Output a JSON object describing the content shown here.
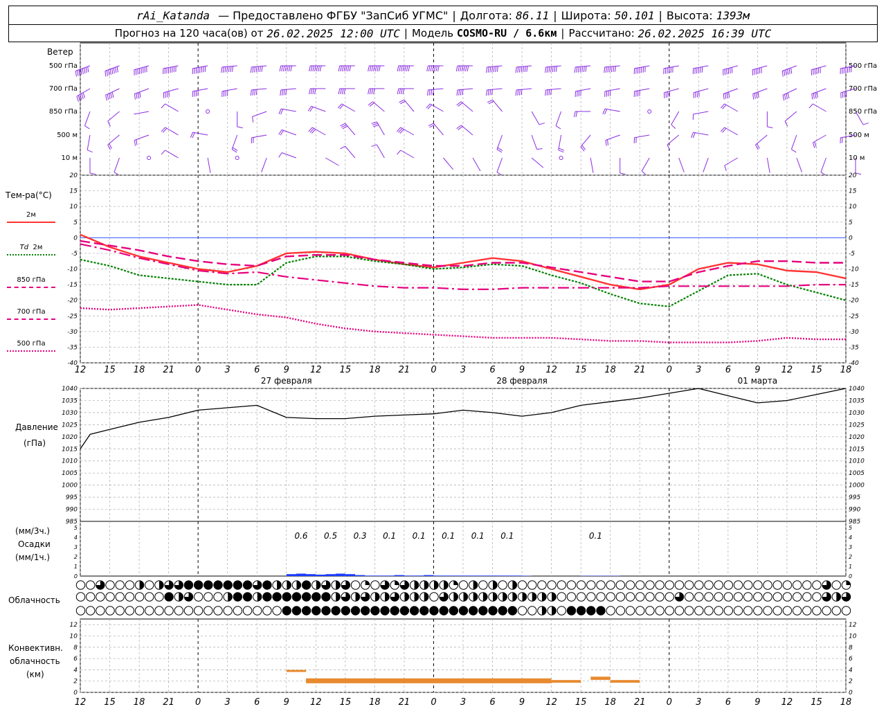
{
  "header": {
    "station": "rAi_Katanda",
    "provider": "— Предоставлено ФГБУ \"ЗапСиб УГМС\"",
    "lon_label": "Долгота:",
    "lon": "86.11",
    "lat_label": "Широта:",
    "lat": "50.101",
    "alt_label": "Высота:",
    "alt": "1393м",
    "forecast_prefix": "Прогноз на 120 часа(ов) от",
    "forecast_time": "26.02.2025 12:00 UTC",
    "model_label": "Модель",
    "model": "COSMO-RU / 6.6км",
    "calc_label": "Рассчитано:",
    "calc_time": "26.02.2025 16:39 UTC"
  },
  "panel_labels": {
    "wind": "Ветер",
    "temp": "Тем-ра(°С)",
    "pressure": "Давление",
    "pressure_unit": "(гПа)",
    "precip_unit_3h": "(мм/3ч.)",
    "precip": "Осадки",
    "precip_unit_1h": "(мм/1ч.)",
    "cloud": "Облачность",
    "conv1": "Конвективн.",
    "conv2": "облачность",
    "conv_unit": "(км)"
  },
  "wind_levels": [
    "500 гПа",
    "700 гПа",
    "850 гПа",
    "500 м",
    "10  м"
  ],
  "legend": {
    "t2m": "2м",
    "td": "Td",
    "td2m": "2м",
    "t850": "850 гПа",
    "t700": "700 гПа",
    "t500": "500 гПа"
  },
  "colors": {
    "t2m": "#ff3333",
    "td2m": "#008000",
    "t850": "#e6007e",
    "t700": "#e6007e",
    "t500": "#e6007e",
    "wind": "#8a2be2",
    "pressure": "#000000",
    "precip": "#1a3cff",
    "conv": "#e88a2e",
    "zero": "#3355ff"
  },
  "time_axis": {
    "tick_labels": [
      "12",
      "15",
      "18",
      "21",
      "0",
      "3",
      "6",
      "9",
      "12",
      "15",
      "18",
      "21",
      "0",
      "3",
      "6",
      "9",
      "12",
      "15",
      "18",
      "21",
      "0",
      "3",
      "6",
      "9",
      "12",
      "15",
      "18"
    ],
    "day_labels": [
      {
        "hour": 21,
        "text": "27 февраля"
      },
      {
        "hour": 45,
        "text": "28 февраля"
      },
      {
        "hour": 69,
        "text": "01 марта"
      }
    ]
  },
  "chart_data": {
    "type": "line",
    "x_unit": "hours since 26.02.2025 12:00 UTC",
    "temperature": {
      "ylim": [
        -40,
        20
      ],
      "yticks": [
        20,
        15,
        10,
        5,
        0,
        -5,
        -10,
        -15,
        -20,
        -25,
        -30,
        -35,
        -40
      ],
      "series": [
        {
          "key": "t2m",
          "x": [
            0,
            3,
            6,
            9,
            12,
            15,
            18,
            21,
            24,
            27,
            30,
            33,
            36,
            39,
            42,
            45,
            48,
            51,
            54,
            57,
            60,
            63,
            66,
            69,
            72,
            75,
            78
          ],
          "values": [
            1,
            -3,
            -6,
            -8,
            -10,
            -11,
            -9,
            -5,
            -4.5,
            -5,
            -7,
            -8.5,
            -9.5,
            -8,
            -6.5,
            -7.5,
            -10,
            -12.5,
            -15,
            -16.5,
            -15,
            -10,
            -8,
            -8.5,
            -10.5,
            -11,
            -13
          ]
        },
        {
          "key": "td2m",
          "x": [
            0,
            3,
            6,
            9,
            12,
            15,
            18,
            21,
            24,
            27,
            30,
            33,
            36,
            39,
            42,
            45,
            48,
            51,
            54,
            57,
            60,
            63,
            66,
            69,
            72,
            75,
            78
          ],
          "values": [
            -7,
            -9,
            -12,
            -13,
            -14,
            -15,
            -15,
            -8,
            -6,
            -6,
            -7.5,
            -8.5,
            -10,
            -9.5,
            -8.5,
            -9,
            -12,
            -14.5,
            -18,
            -21,
            -22,
            -17,
            -12,
            -11.5,
            -15,
            -17.5,
            -20
          ]
        },
        {
          "key": "t850",
          "x": [
            0,
            3,
            6,
            9,
            12,
            15,
            18,
            21,
            24,
            27,
            30,
            33,
            36,
            39,
            42,
            45,
            48,
            51,
            54,
            57,
            60,
            63,
            66,
            69,
            72,
            75,
            78
          ],
          "values": [
            -1,
            -2.5,
            -4,
            -6,
            -7.5,
            -8.5,
            -9,
            -6,
            -5.5,
            -5.5,
            -7,
            -8,
            -9,
            -9,
            -8,
            -8,
            -9.5,
            -11,
            -12.5,
            -14,
            -14,
            -11,
            -9,
            -7.5,
            -7.5,
            -8,
            -8
          ]
        },
        {
          "key": "t700",
          "x": [
            0,
            3,
            6,
            9,
            12,
            15,
            18,
            21,
            24,
            27,
            30,
            33,
            36,
            39,
            42,
            45,
            48,
            51,
            54,
            57,
            60,
            63,
            66,
            69,
            72,
            75,
            78
          ],
          "values": [
            -2,
            -4,
            -6.5,
            -8.5,
            -10.5,
            -11.5,
            -11,
            -12.5,
            -13.5,
            -14.5,
            -15.5,
            -16,
            -16,
            -16.5,
            -16.5,
            -16,
            -16,
            -16,
            -16,
            -16,
            -15.5,
            -15.5,
            -15.5,
            -15.5,
            -15.5,
            -15,
            -15
          ]
        },
        {
          "key": "t500",
          "x": [
            0,
            3,
            6,
            9,
            12,
            15,
            18,
            21,
            24,
            27,
            30,
            33,
            36,
            39,
            42,
            45,
            48,
            51,
            54,
            57,
            60,
            63,
            66,
            69,
            72,
            75,
            78
          ],
          "values": [
            -22.5,
            -23,
            -22.5,
            -22,
            -21.5,
            -23,
            -24.5,
            -25.5,
            -27.5,
            -29,
            -30,
            -30.5,
            -31,
            -31.5,
            -32,
            -32,
            -32,
            -32.5,
            -33,
            -33,
            -33.5,
            -33.5,
            -33.5,
            -33,
            -32,
            -32.5,
            -32.5
          ]
        }
      ]
    },
    "pressure": {
      "ylim": [
        985,
        1040
      ],
      "yticks": [
        1040,
        1035,
        1030,
        1025,
        1020,
        1015,
        1010,
        1005,
        1000,
        995,
        990,
        985
      ],
      "x": [
        0,
        1,
        3,
        6,
        9,
        12,
        15,
        18,
        21,
        24,
        27,
        30,
        33,
        36,
        39,
        42,
        45,
        48,
        51,
        54,
        57,
        60,
        63,
        66,
        69,
        72,
        75,
        78
      ],
      "values": [
        1015,
        1021,
        1023,
        1026,
        1028,
        1031,
        1032,
        1033,
        1028,
        1027.5,
        1027.5,
        1028.5,
        1029,
        1029.5,
        1031,
        1030,
        1028.5,
        1030,
        1033,
        1034.5,
        1036,
        1038,
        1040,
        1037,
        1034,
        1035,
        1037.5,
        1040
      ]
    },
    "precip": {
      "ylim": [
        0,
        5
      ],
      "yticks": [
        5,
        4,
        3,
        2,
        1,
        0
      ],
      "labels_3h": [
        {
          "x": 22.5,
          "text": "0.6"
        },
        {
          "x": 25.5,
          "text": "0.5"
        },
        {
          "x": 28.5,
          "text": "0.3"
        },
        {
          "x": 31.5,
          "text": "0.1"
        },
        {
          "x": 34.5,
          "text": "0.1"
        },
        {
          "x": 37.5,
          "text": "0.1"
        },
        {
          "x": 40.5,
          "text": "0.1"
        },
        {
          "x": 43.5,
          "text": "0.1"
        },
        {
          "x": 52.5,
          "text": "0.1"
        }
      ],
      "hourly_x": [
        21,
        22,
        23,
        24,
        25,
        26,
        27,
        28,
        29,
        30,
        31,
        32,
        33,
        34,
        35,
        36,
        37,
        38,
        39,
        40,
        41,
        42,
        43,
        44,
        45,
        51,
        52,
        53,
        54
      ],
      "hourly_values": [
        0.2,
        0.25,
        0.2,
        0.15,
        0.2,
        0.25,
        0.2,
        0.1,
        0.05,
        0.05,
        0.05,
        0.1,
        0.05,
        0.05,
        0.1,
        0.05,
        0.05,
        0.05,
        0.05,
        0.05,
        0.05,
        0.05,
        0.05,
        0.05,
        0.03,
        0.03,
        0.03,
        0.03,
        0.03
      ]
    },
    "cloud": {
      "rows": 3,
      "levels_lmh_each_hour": "cover fraction 0–1 per hour (row 0 = top)",
      "x_step_hours": 1,
      "row0": [
        0,
        0,
        0.75,
        0,
        0,
        0,
        0.5,
        0,
        0.5,
        0.75,
        0.75,
        1,
        1,
        1,
        1,
        1,
        1,
        1,
        0.75,
        1,
        0.5,
        0.5,
        0.5,
        1,
        0.5,
        0.75,
        0.5,
        0.75,
        0,
        0.25,
        0,
        0.75,
        0.25,
        0.75,
        0.5,
        0.5,
        0.5,
        0.5,
        0.25,
        0,
        0.5,
        0,
        0.5,
        0,
        0.5,
        0,
        0,
        0,
        0,
        0,
        0,
        0,
        0,
        0,
        0,
        0,
        0,
        0,
        0,
        0,
        0,
        0,
        0,
        0,
        0,
        0,
        0,
        0,
        0,
        0,
        0,
        0,
        0,
        0,
        0,
        0,
        0.75,
        0,
        0.25
      ],
      "row1": [
        0,
        0,
        0,
        0,
        0,
        0,
        0,
        0,
        0,
        1,
        0.5,
        0.75,
        0,
        0,
        0,
        0.5,
        1,
        1,
        0.5,
        1,
        1,
        1,
        1,
        1,
        1,
        1,
        0.5,
        0.75,
        0.5,
        0.75,
        0.5,
        0.5,
        0.75,
        0.5,
        0.5,
        0.5,
        0,
        0.75,
        0.5,
        0.5,
        0.5,
        0.5,
        0.5,
        0.5,
        0.5,
        0.5,
        0.5,
        0.5,
        0.5,
        0,
        0,
        0,
        0,
        0,
        0,
        0,
        0,
        0,
        0,
        0,
        0,
        0.75,
        0,
        0,
        0,
        0,
        0,
        0,
        0,
        0,
        0,
        0,
        0,
        0,
        0,
        0,
        0.75,
        0.5,
        0.75
      ],
      "row2": [
        0,
        0,
        0,
        0,
        0,
        0,
        0,
        0,
        0,
        0,
        0,
        0,
        0,
        0,
        0,
        0,
        0,
        0,
        0,
        0,
        0,
        1,
        1,
        1,
        1,
        1,
        1,
        1,
        1,
        1,
        1,
        1,
        1,
        1,
        1,
        1,
        1,
        1,
        1,
        1,
        1,
        1,
        1,
        1,
        1,
        0,
        0,
        0.5,
        0.5,
        0,
        1,
        1,
        1,
        1,
        0,
        0,
        0,
        0,
        0,
        0,
        0,
        0,
        0,
        0,
        0,
        0,
        0,
        0,
        0,
        0,
        0,
        0,
        0,
        0,
        0,
        0,
        0,
        0,
        0
      ]
    },
    "convective": {
      "ylim": [
        0,
        13
      ],
      "yticks": [
        12,
        10,
        8,
        6,
        4,
        2,
        0
      ],
      "segments": [
        {
          "x0": 21,
          "x1": 23,
          "top": 3.8,
          "base": 3.8
        },
        {
          "x0": 23,
          "x1": 48,
          "top": 2.3,
          "base": 1.8
        },
        {
          "x0": 48,
          "x1": 51,
          "top": 2.0,
          "base": 1.9
        },
        {
          "x0": 52,
          "x1": 54,
          "top": 2.6,
          "base": 2.4
        },
        {
          "x0": 54,
          "x1": 57,
          "top": 2.0,
          "base": 1.9
        }
      ]
    },
    "wind_barbs": {
      "levels": [
        "500 гПа",
        "700 гПа",
        "850 гПа",
        "500 м",
        "10  м"
      ],
      "dir_deg": [
        [
          250,
          250,
          255,
          260,
          260,
          265,
          265,
          270,
          270,
          270,
          270,
          270,
          270,
          270,
          265,
          265,
          265,
          265,
          265,
          260,
          260,
          260,
          255,
          255,
          250,
          255,
          260
        ],
        [
          240,
          245,
          250,
          255,
          260,
          260,
          265,
          265,
          270,
          270,
          270,
          270,
          265,
          265,
          265,
          265,
          265,
          260,
          260,
          260,
          255,
          255,
          250,
          250,
          245,
          250,
          255
        ],
        [
          200,
          230,
          260,
          300,
          320,
          180,
          250,
          280,
          290,
          300,
          310,
          320,
          300,
          310,
          320,
          150,
          200,
          270,
          280,
          250,
          210,
          260,
          300,
          180,
          230,
          300,
          150
        ],
        [
          190,
          230,
          250,
          300,
          280,
          200,
          260,
          290,
          300,
          320,
          330,
          300,
          320,
          310,
          200,
          160,
          190,
          220,
          250,
          260,
          230,
          280,
          300,
          230,
          200,
          240,
          260
        ],
        [
          180,
          200,
          140,
          300,
          170,
          160,
          200,
          290,
          120,
          320,
          330,
          300,
          140,
          150,
          200,
          130,
          160,
          170,
          180,
          210,
          160,
          200,
          240,
          170,
          160,
          200,
          180
        ]
      ],
      "speed_ms": [
        [
          25,
          25,
          22,
          20,
          20,
          18,
          18,
          17,
          17,
          17,
          17,
          17,
          17,
          17,
          17,
          17,
          17,
          17,
          17,
          17,
          16,
          16,
          16,
          15,
          15,
          16,
          17
        ],
        [
          12,
          12,
          11,
          10,
          10,
          10,
          10,
          10,
          11,
          11,
          11,
          11,
          11,
          10,
          10,
          10,
          10,
          10,
          10,
          10,
          9,
          9,
          9,
          9,
          9,
          10,
          10
        ],
        [
          3,
          3,
          1,
          2,
          0,
          2,
          3,
          4,
          5,
          5,
          6,
          6,
          5,
          5,
          4,
          3,
          3,
          4,
          4,
          0,
          2,
          3,
          4,
          3,
          2,
          3,
          2
        ],
        [
          3,
          4,
          5,
          6,
          5,
          4,
          5,
          6,
          7,
          7,
          8,
          7,
          6,
          6,
          4,
          3,
          4,
          5,
          5,
          4,
          3,
          4,
          5,
          4,
          3,
          4,
          5
        ],
        [
          2,
          2,
          0,
          2,
          1,
          0,
          1,
          2,
          1,
          2,
          3,
          2,
          1,
          1,
          2,
          1,
          0,
          1,
          2,
          2,
          1,
          1,
          2,
          1,
          1,
          2,
          2
        ]
      ]
    }
  }
}
